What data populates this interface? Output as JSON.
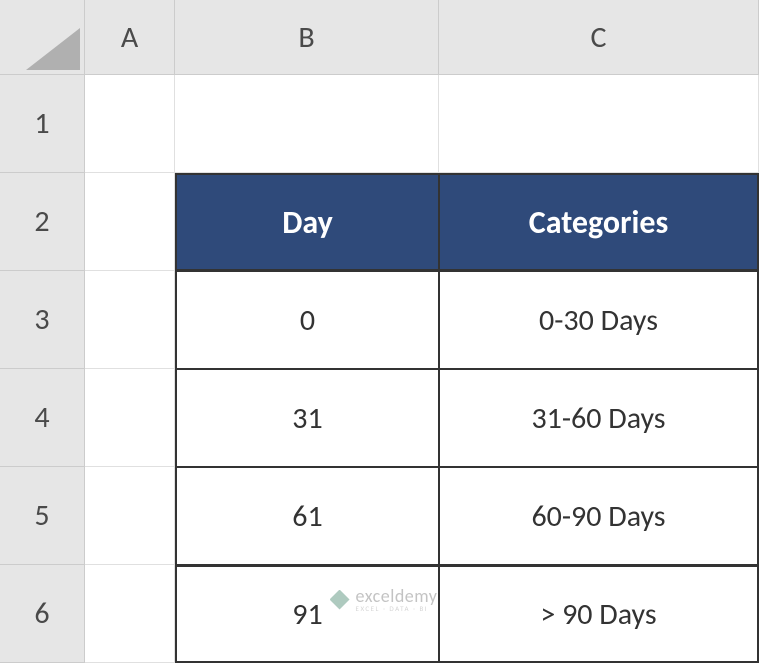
{
  "columns": {
    "a": "A",
    "b": "B",
    "c": "C"
  },
  "rows": {
    "r1": "1",
    "r2": "2",
    "r3": "3",
    "r4": "4",
    "r5": "5",
    "r6": "6"
  },
  "table": {
    "headers": {
      "day": "Day",
      "categories": "Categories"
    },
    "data": [
      {
        "day": "0",
        "category": "0-30 Days"
      },
      {
        "day": "31",
        "category": "31-60 Days"
      },
      {
        "day": "61",
        "category": "60-90 Days"
      },
      {
        "day": "91",
        "category": "> 90 Days"
      }
    ]
  },
  "watermark": {
    "main": "exceldemy",
    "sub": "EXCEL · DATA · BI"
  }
}
